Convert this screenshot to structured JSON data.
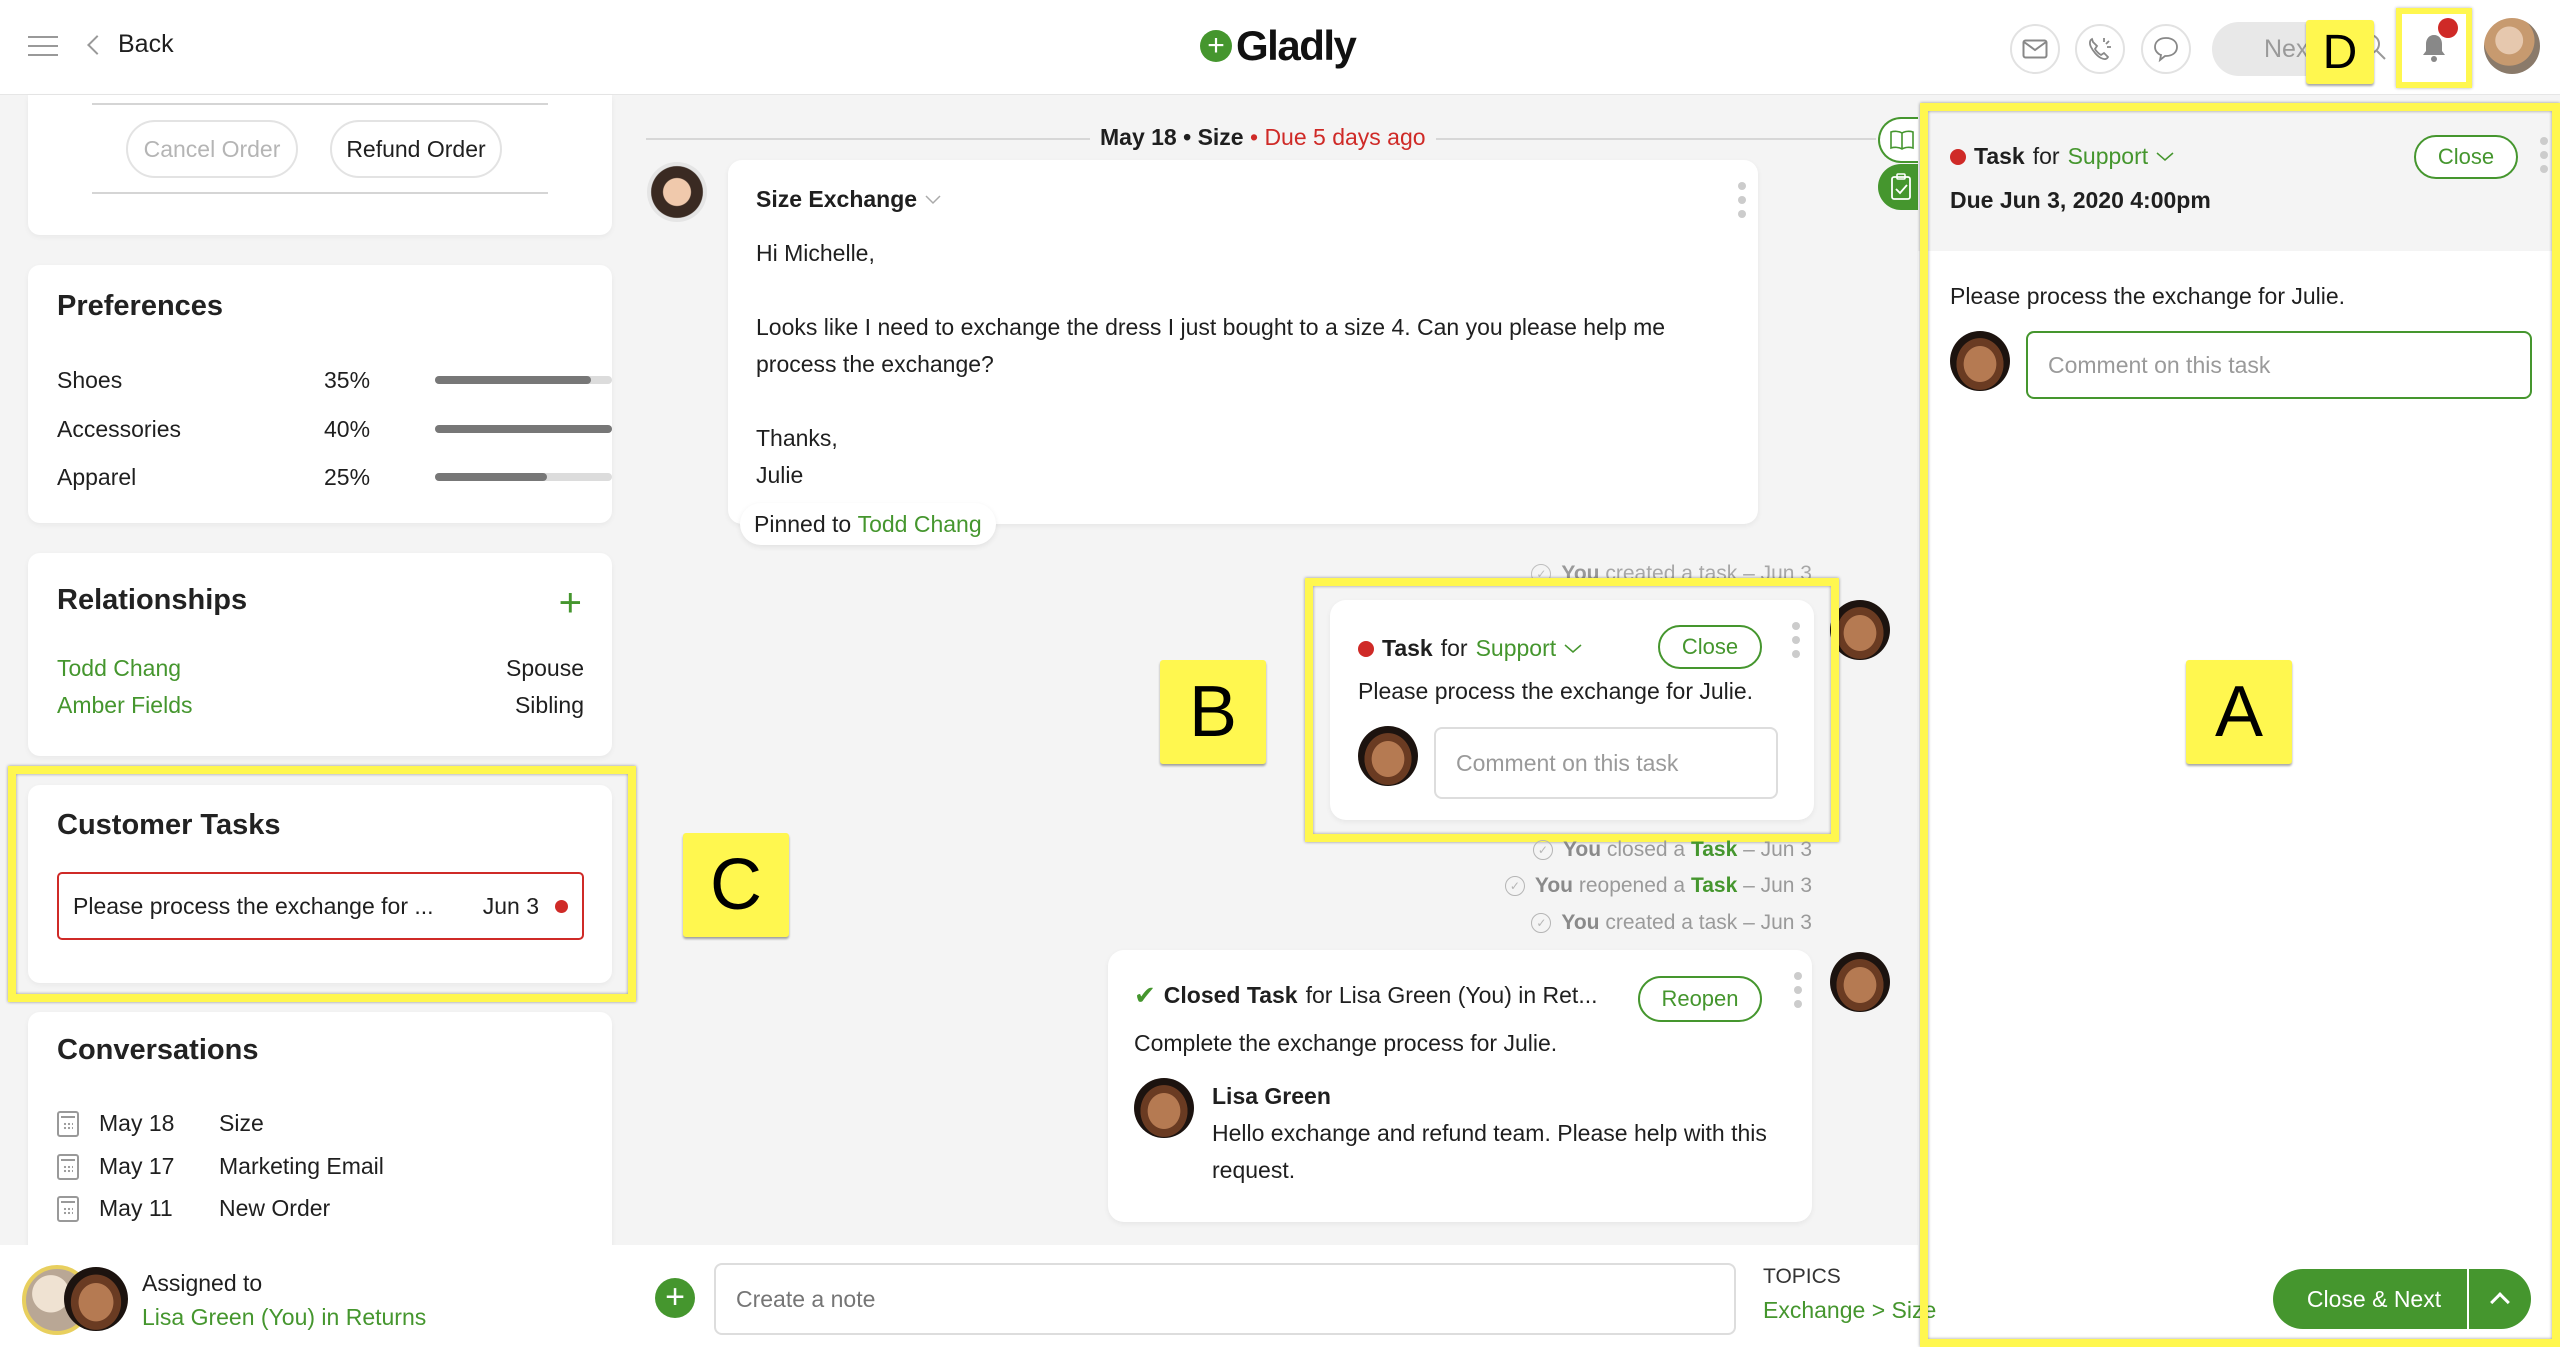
{
  "app": {
    "name": "Gladly",
    "back_label": "Back"
  },
  "topbar": {
    "icons": [
      "email-icon",
      "phone-icon",
      "chat-icon"
    ],
    "next_label": "Next",
    "notification_dot_color": "#cf2a27"
  },
  "annotations": {
    "a": "A",
    "b": "B",
    "c": "C",
    "d": "D"
  },
  "order_actions": {
    "cancel_label": "Cancel Order",
    "refund_label": "Refund Order"
  },
  "preferences": {
    "title": "Preferences",
    "items": [
      {
        "label": "Shoes",
        "percent_label": "35%",
        "bar_fill": 0.88
      },
      {
        "label": "Accessories",
        "percent_label": "40%",
        "bar_fill": 1.0
      },
      {
        "label": "Apparel",
        "percent_label": "25%",
        "bar_fill": 0.63
      }
    ]
  },
  "relationships": {
    "title": "Relationships",
    "items": [
      {
        "name": "Todd Chang",
        "relation": "Spouse"
      },
      {
        "name": "Amber Fields",
        "relation": "Sibling"
      }
    ]
  },
  "customer_tasks": {
    "title": "Customer Tasks",
    "items": [
      {
        "text": "Please process the exchange for ...",
        "date": "Jun 3"
      }
    ]
  },
  "conversations": {
    "title": "Conversations",
    "items": [
      {
        "date": "May 18",
        "topic": "Size"
      },
      {
        "date": "May 17",
        "topic": "Marketing Email"
      },
      {
        "date": "May 11",
        "topic": "New Order"
      }
    ]
  },
  "timeline": {
    "day_header": {
      "date": "May 18",
      "topic": "Size",
      "due": "Due 5 days ago",
      "sep": "•"
    },
    "message": {
      "subject": "Size Exchange",
      "greeting": "Hi Michelle,",
      "body": "Looks like I need to exchange the dress I just bought to a size 4. Can you please help me process the exchange?",
      "signoff": "Thanks,",
      "signature": "Julie",
      "pinned_prefix": "Pinned to",
      "pinned_to": "Todd Chang"
    },
    "activity_top": {
      "actor": "You",
      "text": "created a task – Jun 3"
    },
    "task_card": {
      "label": "Task",
      "for_word": "for",
      "team": "Support",
      "close_label": "Close",
      "description": "Please process the exchange for Julie.",
      "comment_placeholder": "Comment on this task"
    },
    "activities": [
      {
        "actor": "You",
        "pre": "closed a",
        "link": "Task",
        "post": "– Jun 3"
      },
      {
        "actor": "You",
        "pre": "reopened a",
        "link": "Task",
        "post": "– Jun 3"
      },
      {
        "actor": "You",
        "pre": "created a task – Jun 3",
        "link": "",
        "post": ""
      }
    ],
    "closed_task": {
      "label": "Closed Task",
      "rest": "for Lisa Green (You) in Ret...",
      "reopen_label": "Reopen",
      "description": "Complete the exchange process for Julie.",
      "commenter": "Lisa Green",
      "comment": "Hello exchange and refund team. Please help with this request."
    }
  },
  "task_panel": {
    "label": "Task",
    "for_word": "for",
    "team": "Support",
    "close_label": "Close",
    "due": "Due Jun 3, 2020 4:00pm",
    "description": "Please process the exchange for Julie.",
    "comment_placeholder": "Comment on this task",
    "close_next_label": "Close & Next"
  },
  "bottom": {
    "assigned_label": "Assigned to",
    "assignee": "Lisa Green (You) in Returns",
    "note_placeholder": "Create a note",
    "topics_label": "TOPICS",
    "topics_value": "Exchange > Size"
  },
  "colors": {
    "brand_green": "#45962e",
    "alert_red": "#cf2a27",
    "highlight_yellow": "#fff74f"
  }
}
